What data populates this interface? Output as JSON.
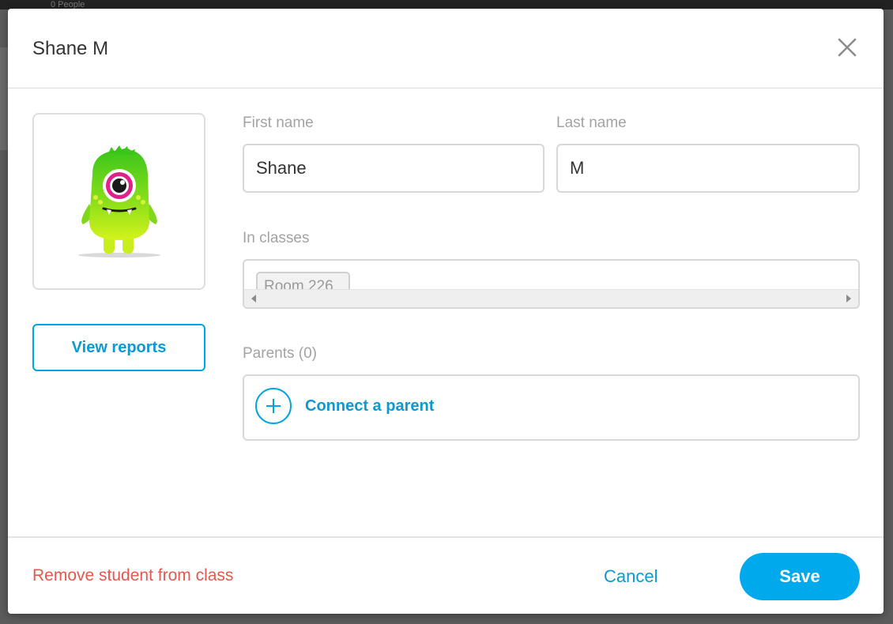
{
  "backdrop": {
    "fragment_text": "0 People"
  },
  "modal": {
    "title": "Shane M",
    "close_icon": "close-icon"
  },
  "avatar": {
    "icon": "green-monster-avatar"
  },
  "view_reports_label": "View reports",
  "form": {
    "first_name": {
      "label": "First name",
      "value": "Shane"
    },
    "last_name": {
      "label": "Last name",
      "value": "M"
    },
    "classes": {
      "label": "In classes",
      "items": [
        "Room 226"
      ]
    },
    "parents": {
      "label": "Parents (0)",
      "connect_label": "Connect a parent"
    }
  },
  "footer": {
    "remove_label": "Remove student from class",
    "cancel_label": "Cancel",
    "save_label": "Save"
  },
  "colors": {
    "accent": "#00a9ec",
    "link_blue": "#0b9ad6",
    "danger": "#e8574c",
    "label_gray": "#a3a3a3"
  }
}
